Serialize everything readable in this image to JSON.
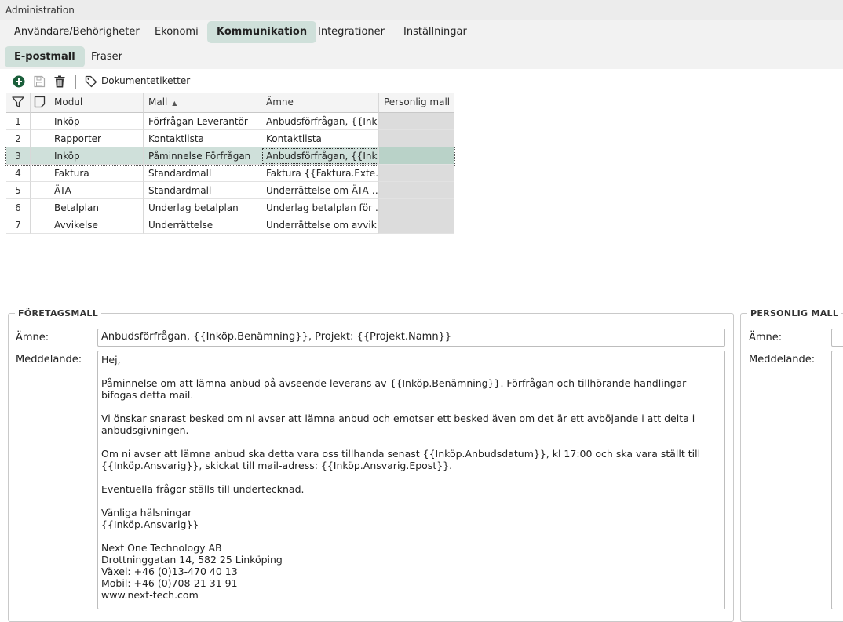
{
  "window": {
    "title": "Administration"
  },
  "tabs": [
    {
      "label": "Användare/Behörigheter"
    },
    {
      "label": "Ekonomi"
    },
    {
      "label": "Kommunikation"
    },
    {
      "label": "Integrationer"
    },
    {
      "label": "Inställningar"
    }
  ],
  "subtabs": [
    {
      "label": "E-postmall"
    },
    {
      "label": "Fraser"
    }
  ],
  "toolbar": {
    "add_icon": "plus-circle-icon",
    "save_icon": "floppy-disk-icon",
    "delete_icon": "trash-icon",
    "tag_icon": "tag-icon",
    "tags_label": "Dokumentetiketter"
  },
  "colors": {
    "accent": "#cfe0da",
    "add_green": "#1a5e3a",
    "locked_cell": "#dcdcdc"
  },
  "grid": {
    "columns": {
      "modul": "Modul",
      "mall": "Mall",
      "amne": "Ämne",
      "personlig": "Personlig mall"
    },
    "sort": {
      "column": "Mall",
      "direction": "ascending",
      "indicator": "▲"
    },
    "selected_row": 3,
    "rows": [
      {
        "num": "1",
        "modul": "Inköp",
        "mall": "Förfrågan Leverantör",
        "amne": "Anbudsförfrågan, {{Ink…",
        "personlig": ""
      },
      {
        "num": "2",
        "modul": "Rapporter",
        "mall": "Kontaktlista",
        "amne": "Kontaktlista",
        "personlig": ""
      },
      {
        "num": "3",
        "modul": "Inköp",
        "mall": "Påminnelse Förfrågan",
        "amne": "Anbudsförfrågan, {{Ink…",
        "personlig": ""
      },
      {
        "num": "4",
        "modul": "Faktura",
        "mall": "Standardmall",
        "amne": "Faktura {{Faktura.Exte…",
        "personlig": ""
      },
      {
        "num": "5",
        "modul": "ÄTA",
        "mall": "Standardmall",
        "amne": "Underrättelse om ÄTA-…",
        "personlig": ""
      },
      {
        "num": "6",
        "modul": "Betalplan",
        "mall": "Underlag betalplan",
        "amne": "Underlag betalplan för …",
        "personlig": ""
      },
      {
        "num": "7",
        "modul": "Avvikelse",
        "mall": "Underrättelse",
        "amne": "Underrättelse om avvik…",
        "personlig": ""
      }
    ]
  },
  "company_template": {
    "legend": "FÖRETAGSMALL",
    "subject_label": "Ämne:",
    "subject_value": "Anbudsförfrågan, {{Inköp.Benämning}}, Projekt: {{Projekt.Namn}}",
    "message_label": "Meddelande:",
    "message_value": "Hej,\n\nPåminnelse om att lämna anbud på avseende leverans av {{Inköp.Benämning}}. Förfrågan och tillhörande handlingar bifogas detta mail.\n\nVi önskar snarast besked om ni avser att lämna anbud och emotser ett besked även om det är ett avböjande i att delta i anbudsgivningen.\n\nOm ni avser att lämna anbud ska detta vara oss tillhanda senast {{Inköp.Anbudsdatum}}, kl 17:00 och ska vara ställt till {{Inköp.Ansvarig}}, skickat till mail-adress: {{Inköp.Ansvarig.Epost}}.\n\nEventuella frågor ställs till undertecknad.\n\nVänliga hälsningar\n{{Inköp.Ansvarig}}\n\nNext One Technology AB\nDrottninggatan 14, 582 25 Linköping\nVäxel: +46 (0)13-470 40 13\nMobil: +46 (0)708-21 31 91\nwww.next-tech.com"
  },
  "personal_template": {
    "legend": "PERSONLIG MALL",
    "subject_label": "Ämne:",
    "subject_value": "",
    "message_label": "Meddelande:",
    "message_value": ""
  }
}
